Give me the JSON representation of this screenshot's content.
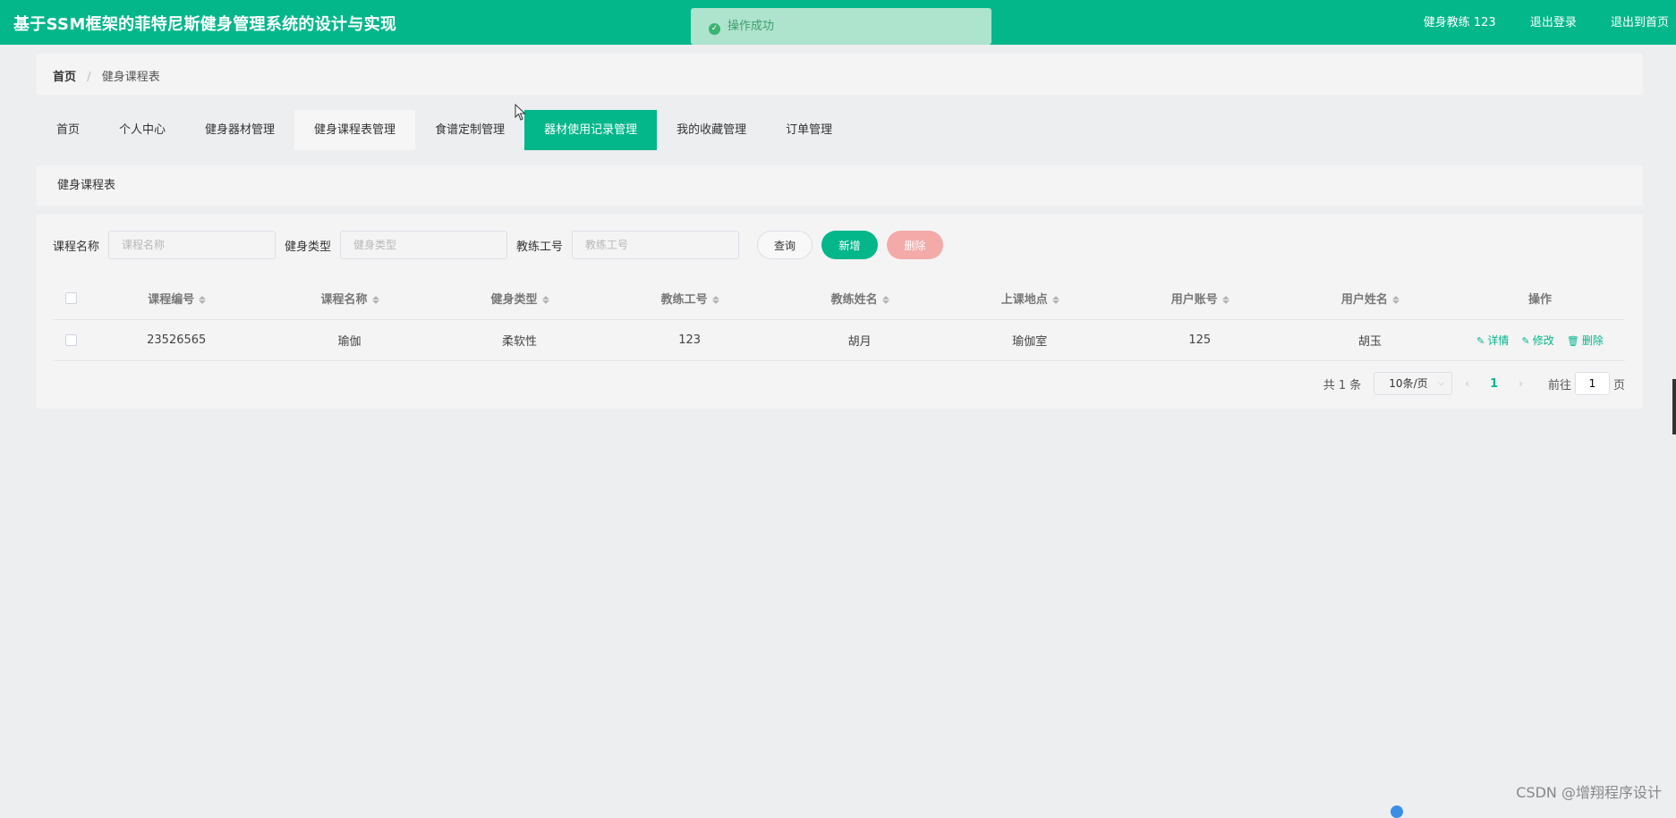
{
  "header": {
    "title": "基于SSM框架的菲特尼斯健身管理系统的设计与实现",
    "user_label": "健身教练 123",
    "logout": "退出登录",
    "exit_home": "退出到首页"
  },
  "toast": {
    "message": "操作成功",
    "icon": "check-circle-icon",
    "color": "#3e9f6a"
  },
  "breadcrumb": {
    "home": "首页",
    "separator": "/",
    "current": "健身课程表"
  },
  "nav": {
    "items": [
      {
        "label": "首页"
      },
      {
        "label": "个人中心"
      },
      {
        "label": "健身器材管理"
      },
      {
        "label": "健身课程表管理"
      },
      {
        "label": "食谱定制管理"
      },
      {
        "label": "器材使用记录管理"
      },
      {
        "label": "我的收藏管理"
      },
      {
        "label": "订单管理"
      }
    ],
    "active_index": 5,
    "hover_index": 3,
    "accent": "#03b78b"
  },
  "panel": {
    "title": "健身课程表"
  },
  "search": {
    "course_name_label": "课程名称",
    "course_name_placeholder": "课程名称",
    "type_label": "健身类型",
    "type_placeholder": "健身类型",
    "coach_id_label": "教练工号",
    "coach_id_placeholder": "教练工号",
    "query_btn": "查询",
    "add_btn": "新增",
    "delete_btn": "删除"
  },
  "table": {
    "columns": [
      "课程编号",
      "课程名称",
      "健身类型",
      "教练工号",
      "教练姓名",
      "上课地点",
      "用户账号",
      "用户姓名",
      "操作"
    ],
    "rows": [
      {
        "cells": [
          "23526565",
          "瑜伽",
          "柔软性",
          "123",
          "胡月",
          "瑜伽室",
          "125",
          "胡玉"
        ],
        "actions": {
          "detail": "详情",
          "edit": "修改",
          "delete": "删除"
        }
      }
    ]
  },
  "pagination": {
    "total": "共 1 条",
    "page_size": "10条/页",
    "current_page": "1",
    "goto_label": "前往",
    "goto_value": "1",
    "page_unit": "页"
  },
  "watermark": "CSDN @增翔程序设计"
}
